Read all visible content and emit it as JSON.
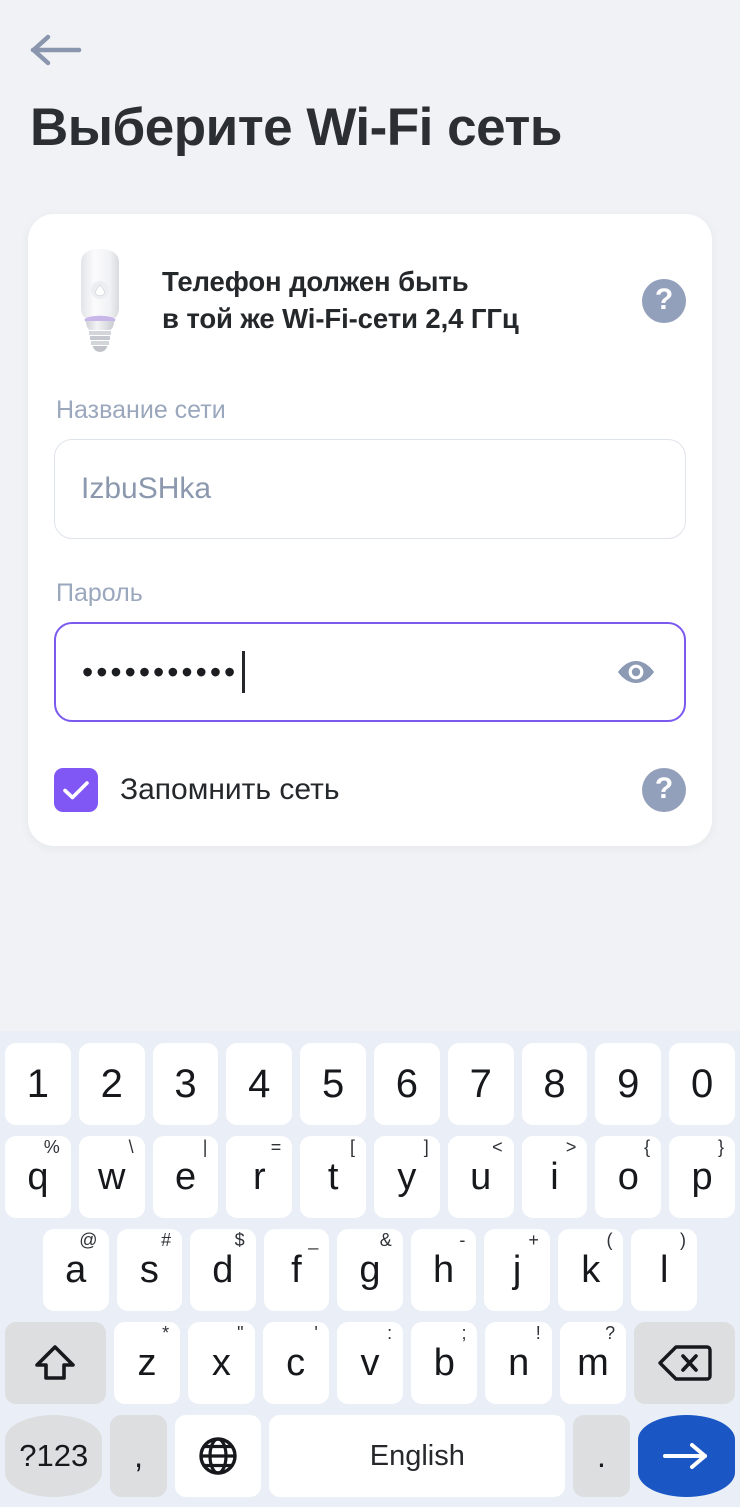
{
  "header": {
    "back_icon": "arrow-left-icon",
    "title": "Выберите Wi-Fi сеть"
  },
  "card": {
    "device_icon": "smart-bulb-icon",
    "hint_text": "Телефон должен быть\nв той же Wi-Fi-сети 2,4 ГГц",
    "hint_help_label": "?",
    "network": {
      "label": "Название сети",
      "value": "IzbuSHka",
      "placeholder": "Название сети"
    },
    "password": {
      "label": "Пароль",
      "value": "•••••••••••",
      "placeholder": "Пароль",
      "masked_char_count": 11,
      "reveal_icon": "eye-icon",
      "focused": true
    },
    "remember": {
      "label": "Запомнить сеть",
      "checked": true,
      "help_label": "?"
    }
  },
  "colors": {
    "page_background": "#f0f2f5",
    "card_background": "#ffffff",
    "title_text": "#2b2f33",
    "label_text": "#9aa7bd",
    "focus_border": "#7b59ef",
    "checkbox_accent": "#8057f5",
    "help_icon": "#93a0bb",
    "keyboard_background": "#eaeff7",
    "key_background": "#ffffff",
    "key_gray": "#dcdee0",
    "enter_key": "#1a56c4"
  },
  "keyboard": {
    "language": "English",
    "rows": [
      {
        "name": "digits-row",
        "keys": [
          {
            "label": "1"
          },
          {
            "label": "2"
          },
          {
            "label": "3"
          },
          {
            "label": "4"
          },
          {
            "label": "5"
          },
          {
            "label": "6"
          },
          {
            "label": "7"
          },
          {
            "label": "8"
          },
          {
            "label": "9"
          },
          {
            "label": "0"
          }
        ]
      },
      {
        "name": "qwerty-row",
        "keys": [
          {
            "label": "q",
            "sup": "%"
          },
          {
            "label": "w",
            "sup": "\\"
          },
          {
            "label": "e",
            "sup": "|"
          },
          {
            "label": "r",
            "sup": "="
          },
          {
            "label": "t",
            "sup": "["
          },
          {
            "label": "y",
            "sup": "]"
          },
          {
            "label": "u",
            "sup": "<"
          },
          {
            "label": "i",
            "sup": ">"
          },
          {
            "label": "o",
            "sup": "{"
          },
          {
            "label": "p",
            "sup": "}"
          }
        ]
      },
      {
        "name": "asdf-row",
        "keys": [
          {
            "label": "a",
            "sup": "@"
          },
          {
            "label": "s",
            "sup": "#"
          },
          {
            "label": "d",
            "sup": "$"
          },
          {
            "label": "f",
            "sup": "_"
          },
          {
            "label": "g",
            "sup": "&"
          },
          {
            "label": "h",
            "sup": "-"
          },
          {
            "label": "j",
            "sup": "+"
          },
          {
            "label": "k",
            "sup": "("
          },
          {
            "label": "l",
            "sup": ")"
          }
        ]
      },
      {
        "name": "zxcv-row",
        "keys": [
          {
            "label": "z",
            "sup": "*"
          },
          {
            "label": "x",
            "sup": "\""
          },
          {
            "label": "c",
            "sup": "'"
          },
          {
            "label": "v",
            "sup": ":"
          },
          {
            "label": "b",
            "sup": ";"
          },
          {
            "label": "n",
            "sup": "!"
          },
          {
            "label": "m",
            "sup": "?"
          }
        ],
        "shift_icon": "shift-icon",
        "backspace_icon": "backspace-icon"
      },
      {
        "name": "bottom-row",
        "symbols_label": "?123",
        "comma_label": ",",
        "globe_icon": "globe-icon",
        "space_label": "English",
        "period_label": ".",
        "enter_icon": "arrow-right-icon"
      }
    ]
  }
}
